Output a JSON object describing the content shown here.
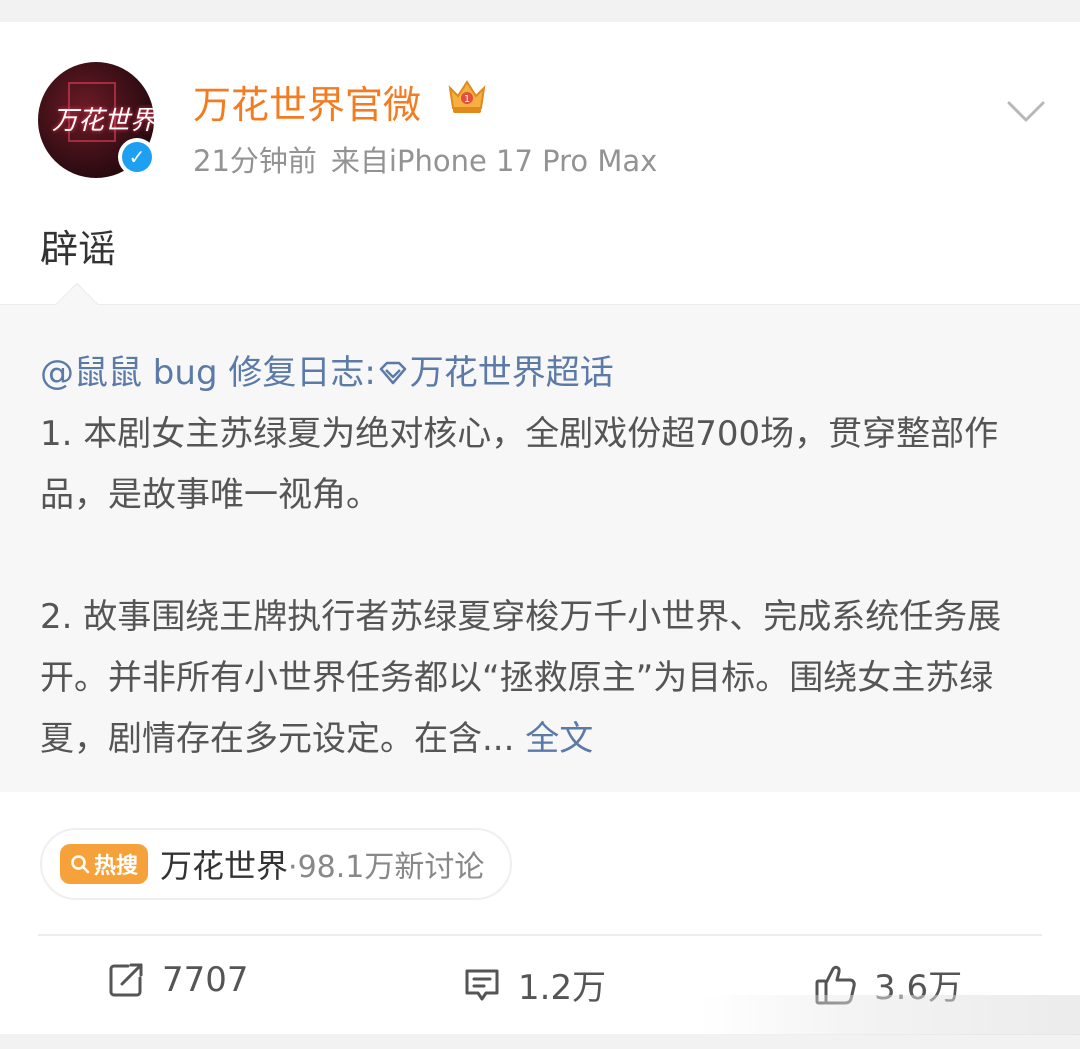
{
  "account": {
    "name": "万花世界官微",
    "avatar_text": "万花世界",
    "time": "21分钟前",
    "source": "来自iPhone 17 Pro Max"
  },
  "post": {
    "text": "辟谣"
  },
  "repost": {
    "mention": "@鼠鼠 bug 修复日志:",
    "topic": "万花世界超话",
    "paragraph1": "1. 本剧女主苏绿夏为绝对核心，全剧戏份超700场，贯穿整部作品，是故事唯一视角。",
    "paragraph2": "2. 故事围绕王牌执行者苏绿夏穿梭万千小世界、完成系统任务展开。并非所有小世界任务都以“拯救原主”为目标。围绕女主苏绿夏，剧情存在多元设定。在含...",
    "more_link": "全文"
  },
  "hot_search": {
    "badge": "热搜",
    "topic": "万花世界",
    "count": "·98.1万新讨论"
  },
  "actions": {
    "repost_count": "7707",
    "comment_count": "1.2万",
    "like_count": "3.6万"
  },
  "colors": {
    "username": "#f47b20",
    "link": "#5b7aa8",
    "hot_badge": "#f7a13a",
    "verified": "#1ea0f2"
  },
  "icons": [
    "crown-icon",
    "chevron-down-icon",
    "verified-icon",
    "diamond-icon",
    "repost-icon",
    "comment-icon",
    "like-icon",
    "search-icon"
  ]
}
